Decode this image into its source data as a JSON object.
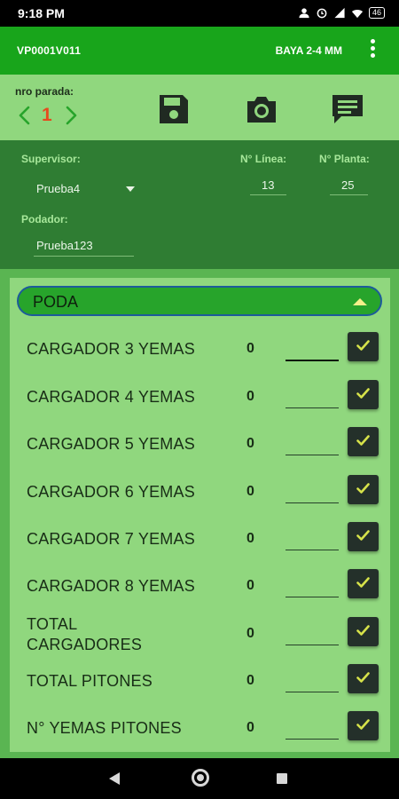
{
  "status_bar": {
    "time": "9:18 PM",
    "battery": "46",
    "icons": [
      "person-icon",
      "alarm-icon",
      "signal-icon",
      "wifi-icon",
      "battery-icon"
    ]
  },
  "app_bar": {
    "code": "VP0001V011",
    "subtitle": "BAYA 2-4 MM",
    "menu_icon": "more-vert-icon"
  },
  "toolbar": {
    "parada_label": "nro parada:",
    "parada_number": "1",
    "actions": [
      "save-icon",
      "camera-icon",
      "comment-icon"
    ]
  },
  "form": {
    "supervisor_label": "Supervisor:",
    "supervisor_value": "Prueba4",
    "linea_label": "N° Línea:",
    "linea_value": "13",
    "planta_label": "N° Planta:",
    "planta_value": "25",
    "podador_label": "Podador:",
    "podador_value": "Prueba123"
  },
  "section": {
    "title": "PODA",
    "rows": [
      {
        "label": "CARGADOR 3 YEMAS",
        "count": "0"
      },
      {
        "label": "CARGADOR 4 YEMAS",
        "count": "0"
      },
      {
        "label": "CARGADOR 5 YEMAS",
        "count": "0"
      },
      {
        "label": "CARGADOR 6 YEMAS",
        "count": "0"
      },
      {
        "label": "CARGADOR 7 YEMAS",
        "count": "0"
      },
      {
        "label": "CARGADOR 8 YEMAS",
        "count": "0"
      },
      {
        "label_line1": "TOTAL",
        "label_line2": "CARGADORES",
        "count": "0"
      },
      {
        "label": "TOTAL PITONES",
        "count": "0"
      },
      {
        "label": "N° YEMAS PITONES",
        "count": "0"
      }
    ]
  },
  "colors": {
    "app_bar": "#18a51b",
    "form_bg": "#2f7d33",
    "panel_bg": "#90d77e",
    "accent_number": "#e64b1e",
    "check_button": "#24302a",
    "check_mark": "#d6e24a"
  }
}
